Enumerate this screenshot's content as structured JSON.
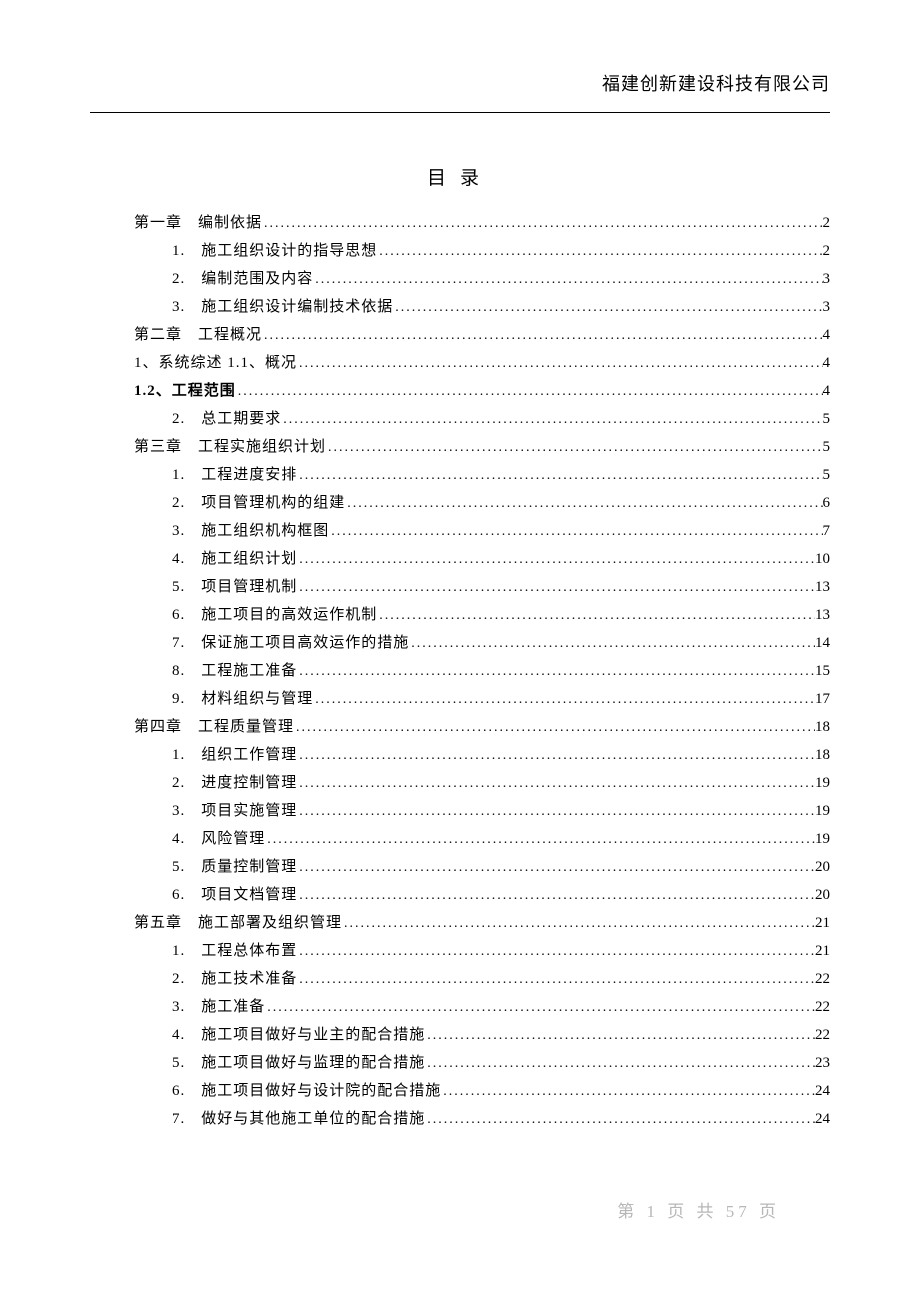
{
  "header": {
    "company": "福建创新建设科技有限公司"
  },
  "toc": {
    "title": "目录",
    "entries": [
      {
        "level": 0,
        "label": "第一章　编制依据",
        "page": "2",
        "bold": false
      },
      {
        "level": 1,
        "label": "1.　施工组织设计的指导思想",
        "page": "2",
        "bold": false
      },
      {
        "level": 1,
        "label": "2.　编制范围及内容",
        "page": "3",
        "bold": false
      },
      {
        "level": 1,
        "label": "3.　施工组织设计编制技术依据",
        "page": "3",
        "bold": false
      },
      {
        "level": 0,
        "label": "第二章　工程概况",
        "page": "4",
        "bold": false
      },
      {
        "level": "a",
        "label": "1、系统综述  1.1、概况",
        "page": "4",
        "bold": false
      },
      {
        "level": "a",
        "label": "1.2、工程范围",
        "page": "4",
        "bold": true
      },
      {
        "level": 1,
        "label": "2.　总工期要求",
        "page": "5",
        "bold": false
      },
      {
        "level": 0,
        "label": "第三章　工程实施组织计划",
        "page": "5",
        "bold": false
      },
      {
        "level": 1,
        "label": "1.　工程进度安排",
        "page": "5",
        "bold": false
      },
      {
        "level": 1,
        "label": "2.　项目管理机构的组建",
        "page": "6",
        "bold": false
      },
      {
        "level": 1,
        "label": "3.　施工组织机构框图",
        "page": "7",
        "bold": false
      },
      {
        "level": 1,
        "label": "4.　施工组织计划",
        "page": "10",
        "bold": false
      },
      {
        "level": 1,
        "label": "5.　项目管理机制",
        "page": "13",
        "bold": false
      },
      {
        "level": 1,
        "label": "6.　施工项目的高效运作机制",
        "page": "13",
        "bold": false
      },
      {
        "level": 1,
        "label": "7.　保证施工项目高效运作的措施",
        "page": "14",
        "bold": false
      },
      {
        "level": 1,
        "label": "8.　工程施工准备",
        "page": "15",
        "bold": false
      },
      {
        "level": 1,
        "label": "9.　材料组织与管理",
        "page": "17",
        "bold": false
      },
      {
        "level": 0,
        "label": "第四章　工程质量管理",
        "page": "18",
        "bold": false
      },
      {
        "level": 1,
        "label": "1.　组织工作管理",
        "page": "18",
        "bold": false
      },
      {
        "level": 1,
        "label": "2.　进度控制管理",
        "page": "19",
        "bold": false
      },
      {
        "level": 1,
        "label": "3.　项目实施管理",
        "page": "19",
        "bold": false
      },
      {
        "level": 1,
        "label": "4.　风险管理",
        "page": "19",
        "bold": false
      },
      {
        "level": 1,
        "label": "5.　质量控制管理",
        "page": "20",
        "bold": false
      },
      {
        "level": 1,
        "label": "6.　项目文档管理",
        "page": "20",
        "bold": false
      },
      {
        "level": 0,
        "label": "第五章　施工部署及组织管理",
        "page": "21",
        "bold": false
      },
      {
        "level": 1,
        "label": "1.　工程总体布置",
        "page": "21",
        "bold": false
      },
      {
        "level": 1,
        "label": "2.　施工技术准备",
        "page": "22",
        "bold": false
      },
      {
        "level": 1,
        "label": "3.　施工准备",
        "page": "22",
        "bold": false
      },
      {
        "level": 1,
        "label": "4.　施工项目做好与业主的配合措施",
        "page": "22",
        "bold": false
      },
      {
        "level": 1,
        "label": "5.　施工项目做好与监理的配合措施",
        "page": "23",
        "bold": false
      },
      {
        "level": 1,
        "label": "6.　施工项目做好与设计院的配合措施",
        "page": "24",
        "bold": false
      },
      {
        "level": 1,
        "label": "7.　做好与其他施工单位的配合措施",
        "page": "24",
        "bold": false
      }
    ]
  },
  "footer": {
    "text": "第 1 页 共 57 页"
  }
}
